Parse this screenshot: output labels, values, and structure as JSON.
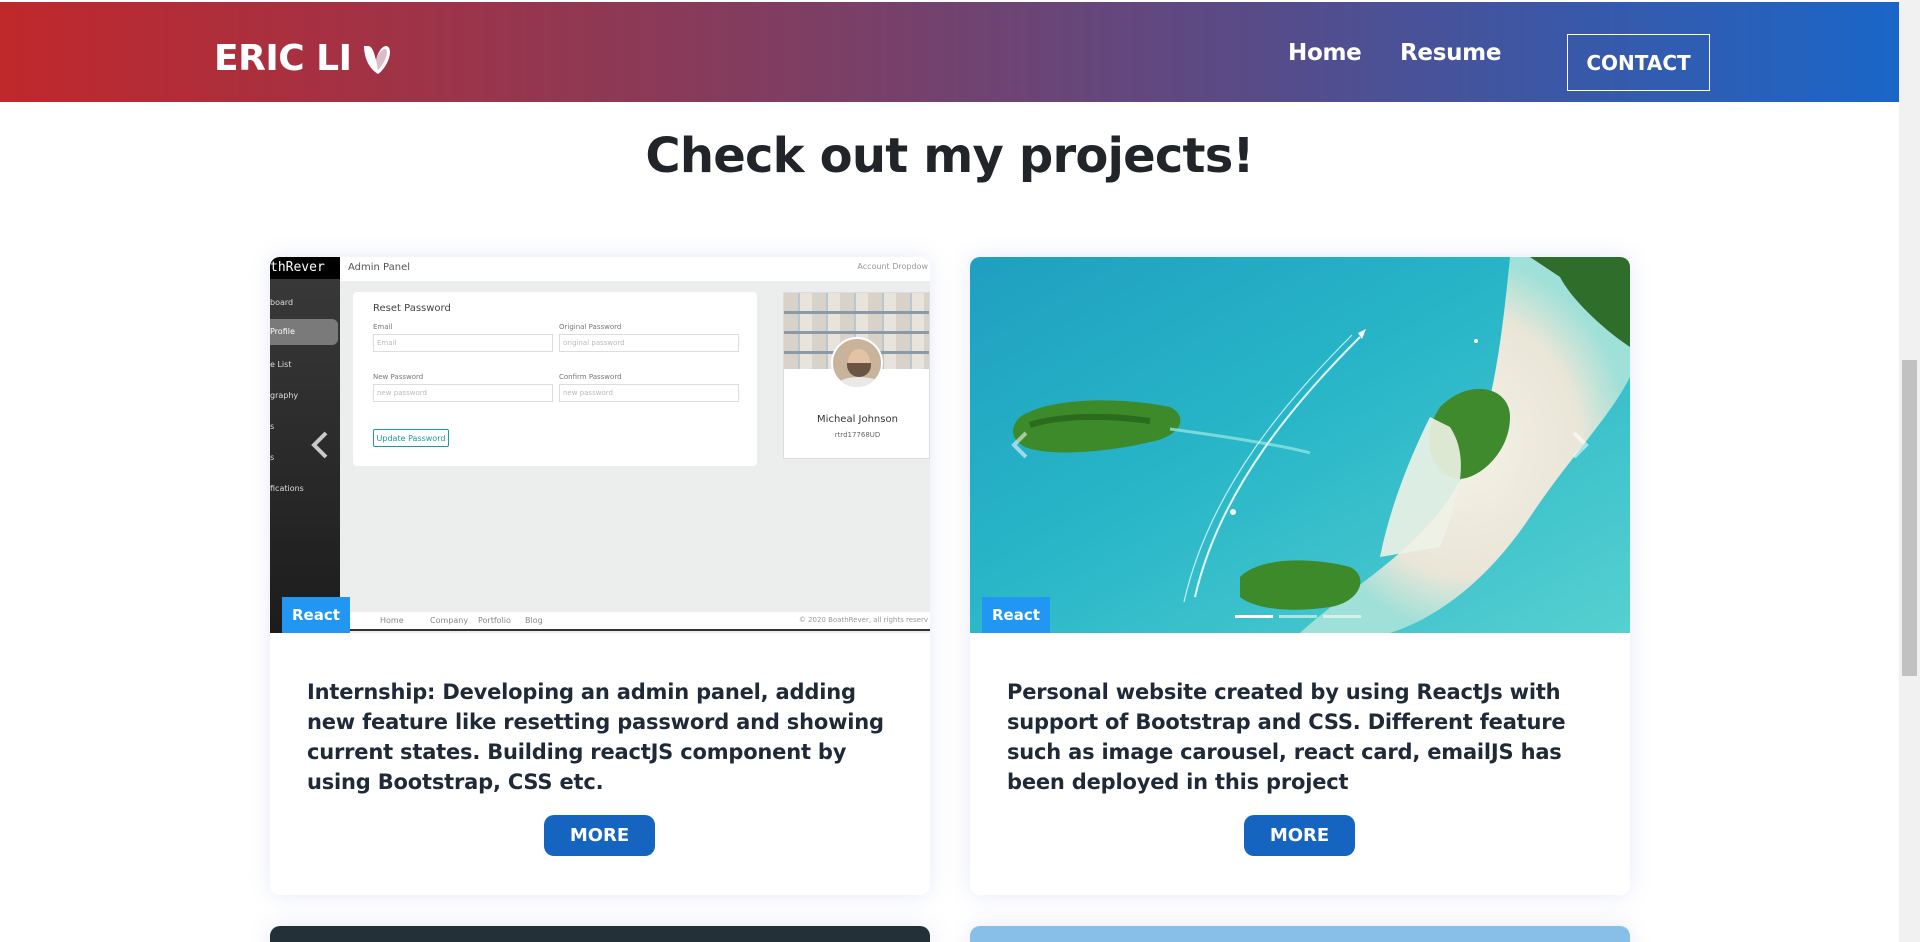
{
  "navbar": {
    "brand": "ERIC LI",
    "links": [
      {
        "label": "Home"
      },
      {
        "label": "Resume"
      }
    ],
    "contact_label": "CONTACT"
  },
  "section": {
    "title": "Check out my projects!"
  },
  "projects": [
    {
      "tag": "React",
      "description": "Internship: Developing an admin panel, adding new feature like resetting password and showing current states. Building reactJS component by using Bootstrap, CSS etc.",
      "button_label": "MORE",
      "screenshot": {
        "brand": "thRever",
        "menu": [
          "board",
          "Profile",
          "e List",
          "graphy",
          "s",
          "s",
          "fications"
        ],
        "top_title": "Admin Panel",
        "top_right": "Account  Dropdow",
        "form_title": "Reset Password",
        "fields": [
          {
            "label": "Email",
            "placeholder": "Email"
          },
          {
            "label": "Original Password",
            "placeholder": "original password"
          },
          {
            "label": "New Password",
            "placeholder": "new password"
          },
          {
            "label": "Confirm Password",
            "placeholder": "new password"
          }
        ],
        "update_button": "Update Password",
        "profile_name": "Micheal Johnson",
        "profile_id": "rtrd17768UD",
        "footer_links": [
          "Home",
          "Company",
          "Portfolio",
          "Blog"
        ],
        "footer_copy": "© 2020 BoathRever, all rights reserv"
      }
    },
    {
      "tag": "React",
      "description": "Personal website created by using ReactJs with support of Bootstrap and CSS. Different feature such as image carousel, react card, emailJS has been deployed in this project",
      "button_label": "MORE",
      "carousel": {
        "slides": 3,
        "active": 0
      }
    }
  ],
  "colors": {
    "nav_gradient_start": "#c0282c",
    "nav_gradient_end": "#1a66c8",
    "tag_bg": "#2196f3",
    "more_button_bg": "#1565c0",
    "text_dark": "#1f2937"
  },
  "icons": {
    "brand_logo": "typo3-logo-icon",
    "prev": "chevron-left-icon",
    "next": "chevron-right-icon"
  }
}
